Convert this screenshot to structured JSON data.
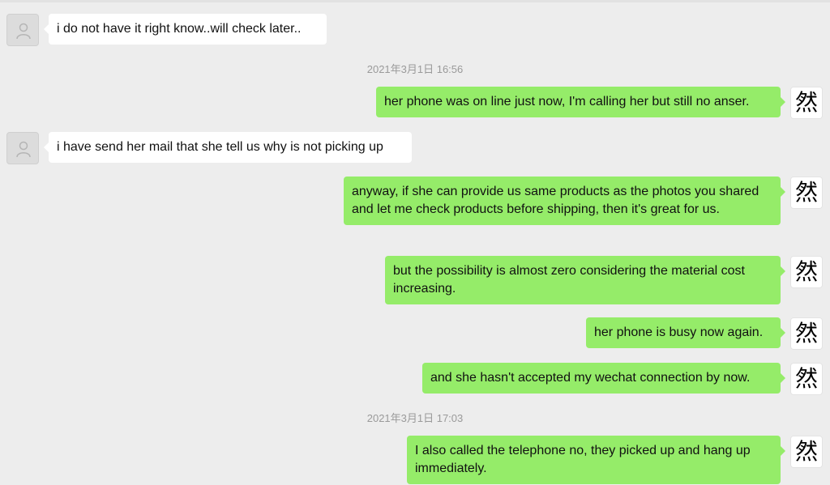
{
  "colors": {
    "background": "#ededed",
    "outgoing_bubble": "#95ec69",
    "incoming_bubble": "#ffffff",
    "timestamp_text": "#9a9a9a"
  },
  "self_avatar_glyph": "然",
  "timestamps": [
    {
      "text": "2021年3月1日 16:56"
    },
    {
      "text": "2021年3月1日 17:03"
    }
  ],
  "messages": [
    {
      "from": "them",
      "text": "i do not have it right know..will check later.."
    },
    {
      "from": "me",
      "text": "her phone was on line just now, I'm calling her but still no anser."
    },
    {
      "from": "them",
      "text": "i have send her mail that she tell us why is not picking up"
    },
    {
      "from": "me",
      "text": "anyway, if she can provide us same products as the photos you shared and let me check products before shipping, then it's great for us."
    },
    {
      "from": "me",
      "text": "but the possibility is almost zero considering the material cost increasing."
    },
    {
      "from": "me",
      "text": "her phone is busy now again."
    },
    {
      "from": "me",
      "text": "and she hasn't accepted my wechat connection by now."
    },
    {
      "from": "me",
      "text": "I also called the telephone no, they picked up and hang up immediately."
    }
  ]
}
